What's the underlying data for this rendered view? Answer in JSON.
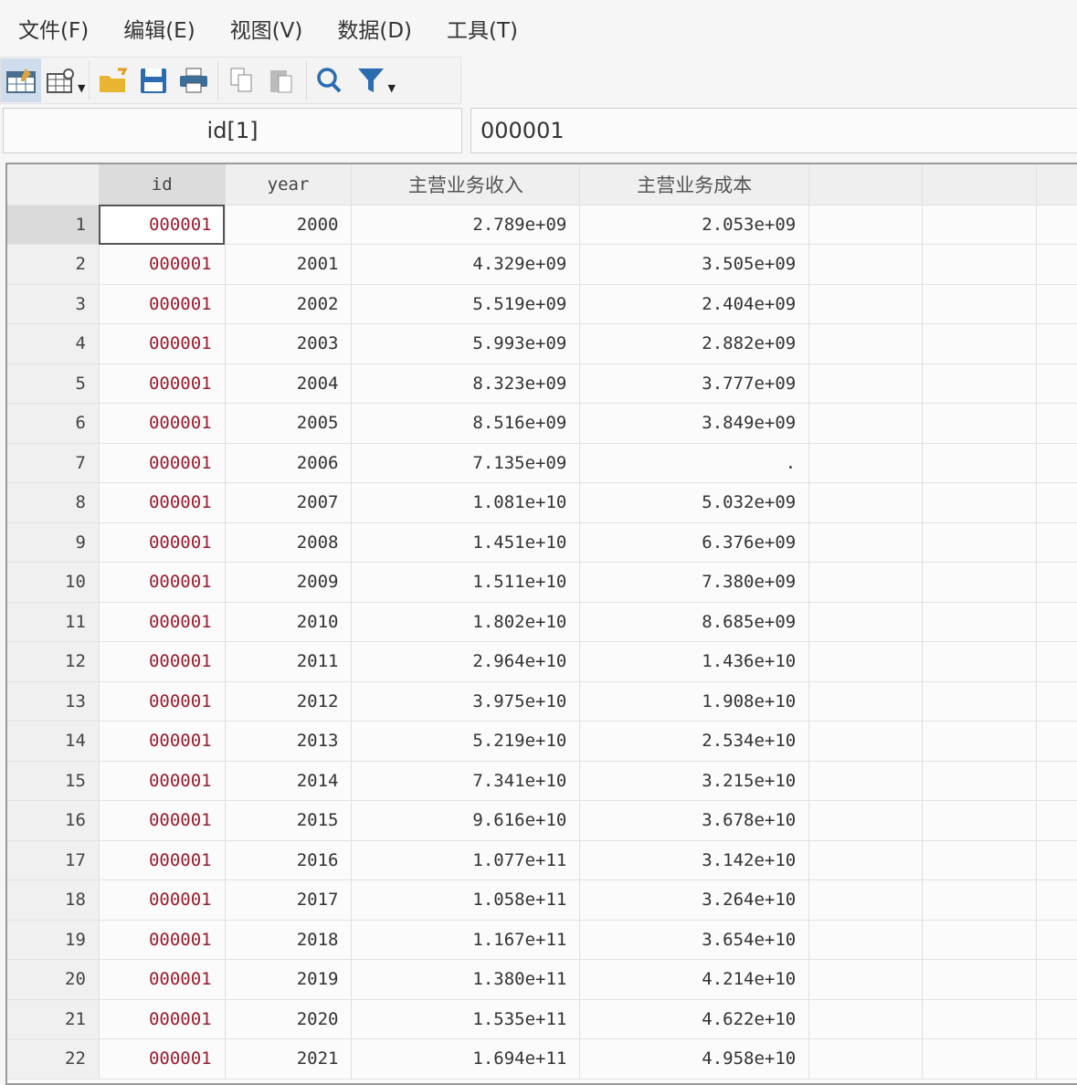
{
  "menu": [
    "文件(F)",
    "编辑(E)",
    "视图(V)",
    "数据(D)",
    "工具(T)"
  ],
  "toolbar": {
    "icons": [
      "edit-mode-icon",
      "browse-mode-icon",
      "open-icon",
      "save-icon",
      "print-icon",
      "copy-icon",
      "paste-icon",
      "find-icon",
      "filter-icon"
    ]
  },
  "varbar": {
    "varname": "id[1]",
    "value": "000001"
  },
  "table": {
    "columns": [
      "id",
      "year",
      "主营业务收入",
      "主营业务成本"
    ],
    "rows": [
      [
        "1",
        "000001",
        "2000",
        "2.789e+09",
        "2.053e+09"
      ],
      [
        "2",
        "000001",
        "2001",
        "4.329e+09",
        "3.505e+09"
      ],
      [
        "3",
        "000001",
        "2002",
        "5.519e+09",
        "2.404e+09"
      ],
      [
        "4",
        "000001",
        "2003",
        "5.993e+09",
        "2.882e+09"
      ],
      [
        "5",
        "000001",
        "2004",
        "8.323e+09",
        "3.777e+09"
      ],
      [
        "6",
        "000001",
        "2005",
        "8.516e+09",
        "3.849e+09"
      ],
      [
        "7",
        "000001",
        "2006",
        "7.135e+09",
        "."
      ],
      [
        "8",
        "000001",
        "2007",
        "1.081e+10",
        "5.032e+09"
      ],
      [
        "9",
        "000001",
        "2008",
        "1.451e+10",
        "6.376e+09"
      ],
      [
        "10",
        "000001",
        "2009",
        "1.511e+10",
        "7.380e+09"
      ],
      [
        "11",
        "000001",
        "2010",
        "1.802e+10",
        "8.685e+09"
      ],
      [
        "12",
        "000001",
        "2011",
        "2.964e+10",
        "1.436e+10"
      ],
      [
        "13",
        "000001",
        "2012",
        "3.975e+10",
        "1.908e+10"
      ],
      [
        "14",
        "000001",
        "2013",
        "5.219e+10",
        "2.534e+10"
      ],
      [
        "15",
        "000001",
        "2014",
        "7.341e+10",
        "3.215e+10"
      ],
      [
        "16",
        "000001",
        "2015",
        "9.616e+10",
        "3.678e+10"
      ],
      [
        "17",
        "000001",
        "2016",
        "1.077e+11",
        "3.142e+10"
      ],
      [
        "18",
        "000001",
        "2017",
        "1.058e+11",
        "3.264e+10"
      ],
      [
        "19",
        "000001",
        "2018",
        "1.167e+11",
        "3.654e+10"
      ],
      [
        "20",
        "000001",
        "2019",
        "1.380e+11",
        "4.214e+10"
      ],
      [
        "21",
        "000001",
        "2020",
        "1.535e+11",
        "4.622e+10"
      ],
      [
        "22",
        "000001",
        "2021",
        "1.694e+11",
        "4.958e+10"
      ]
    ]
  },
  "colors": {
    "id_text": "#9b1c2e",
    "accent": "#2b6cb0"
  }
}
